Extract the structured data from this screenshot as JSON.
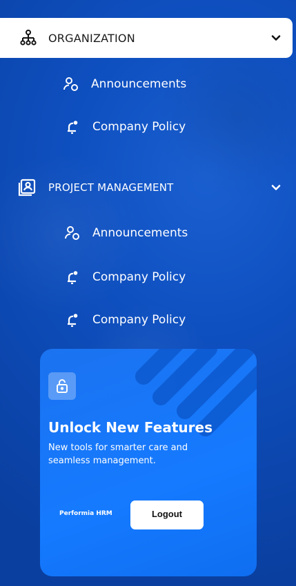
{
  "sections": [
    {
      "title": "ORGANIZATION",
      "icon": "org-chart-icon",
      "expanded": true,
      "items": [
        {
          "label": "Announcements",
          "icon": "users-icon"
        },
        {
          "label": "Company Policy",
          "icon": "bell-icon"
        }
      ]
    },
    {
      "title": "PROJECT MANAGEMENT",
      "icon": "id-card-icon",
      "expanded": true,
      "items": [
        {
          "label": "Announcements",
          "icon": "users-icon"
        },
        {
          "label": "Company Policy",
          "icon": "bell-icon"
        },
        {
          "label": "Company Policy",
          "icon": "bell-icon"
        }
      ]
    }
  ],
  "promo": {
    "title": "Unlock New Features",
    "description": "New tools for smarter care and seamless management.",
    "brand": "Performia HRM",
    "logout_label": "Logout",
    "icon": "lock-icon"
  },
  "colors": {
    "background": "#0e4fbf",
    "card": "#157aff",
    "active_bg": "#ffffff",
    "text_dark": "#1a1a1a"
  }
}
